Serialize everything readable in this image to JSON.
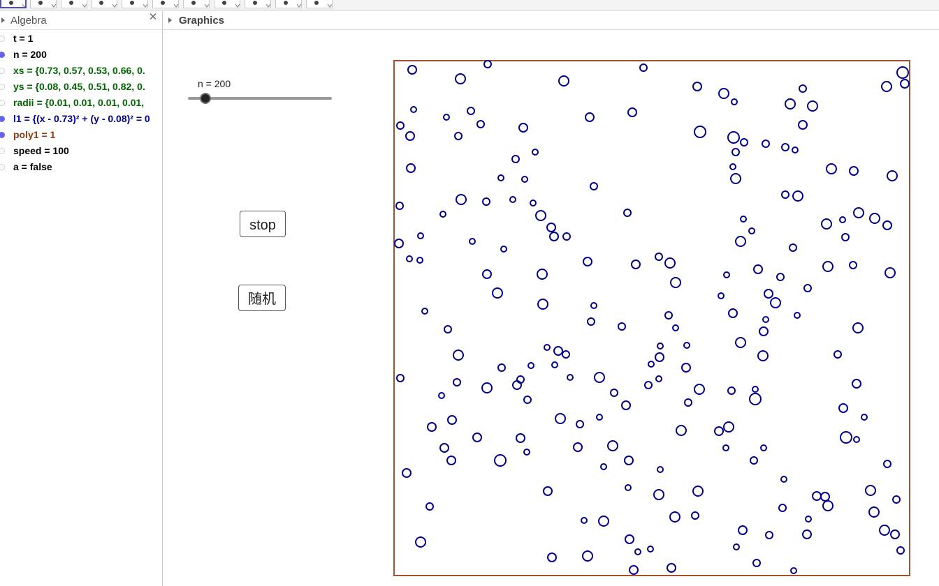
{
  "toolbar": {
    "tool_count": 11
  },
  "algebra": {
    "title": "Algebra",
    "close_label": "✕",
    "items": [
      {
        "text": "t = 1",
        "color": "#000000",
        "shown": false
      },
      {
        "text": "n = 200",
        "color": "#000000",
        "shown": true
      },
      {
        "text": "xs = {0.73, 0.57, 0.53, 0.66, 0.",
        "color": "#006400",
        "shown": false
      },
      {
        "text": "ys = {0.08, 0.45, 0.51, 0.82, 0.",
        "color": "#006400",
        "shown": false
      },
      {
        "text": "radii = {0.01, 0.01, 0.01, 0.01,",
        "color": "#006400",
        "shown": false
      },
      {
        "text": "l1 = {(x - 0.73)² + (y - 0.08)² = 0",
        "color": "#00008b",
        "shown": true
      },
      {
        "text": "poly1 = 1",
        "color": "#8b3a0f",
        "shown": true
      },
      {
        "text": "speed = 100",
        "color": "#000000",
        "shown": false
      },
      {
        "text": "a = false",
        "color": "#000000",
        "shown": false
      }
    ]
  },
  "graphics": {
    "title": "Graphics",
    "slider": {
      "label": "n = 200",
      "value": 200
    },
    "stop_button": "stop",
    "random_button": "随机",
    "colors": {
      "square": "#a0522d",
      "circles": "#00008b"
    }
  }
}
